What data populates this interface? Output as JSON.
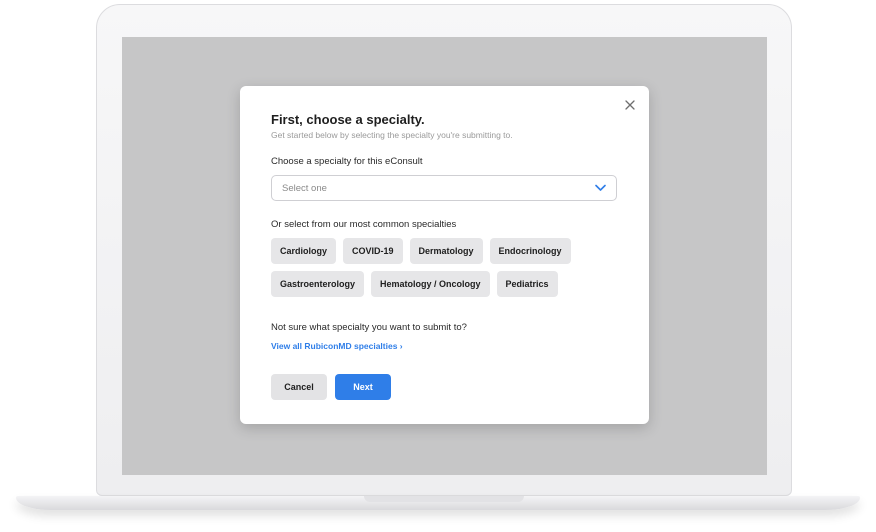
{
  "modal": {
    "title": "First, choose a specialty.",
    "subtitle": "Get started below by selecting the specialty you're submitting to.",
    "select_label": "Choose a specialty for this eConsult",
    "select_value": "Select one",
    "common_label": "Or select from our most common specialties",
    "chips_row1": [
      "Cardiology",
      "COVID-19",
      "Dermatology",
      "Endocrinology"
    ],
    "chips_row2": [
      "Gastroenterology",
      "Hematology / Oncology",
      "Pediatrics"
    ],
    "not_sure_text": "Not sure what specialty you want to submit to?",
    "view_all_link": "View all RubiconMD specialties ›",
    "cancel_label": "Cancel",
    "next_label": "Next"
  },
  "colors": {
    "accent": "#2f7ee8",
    "chip_bg": "#e6e6e8",
    "screen_bg": "#c6c6c7"
  },
  "icons": {
    "close": "close-icon",
    "dropdown": "chevron-down-icon"
  }
}
